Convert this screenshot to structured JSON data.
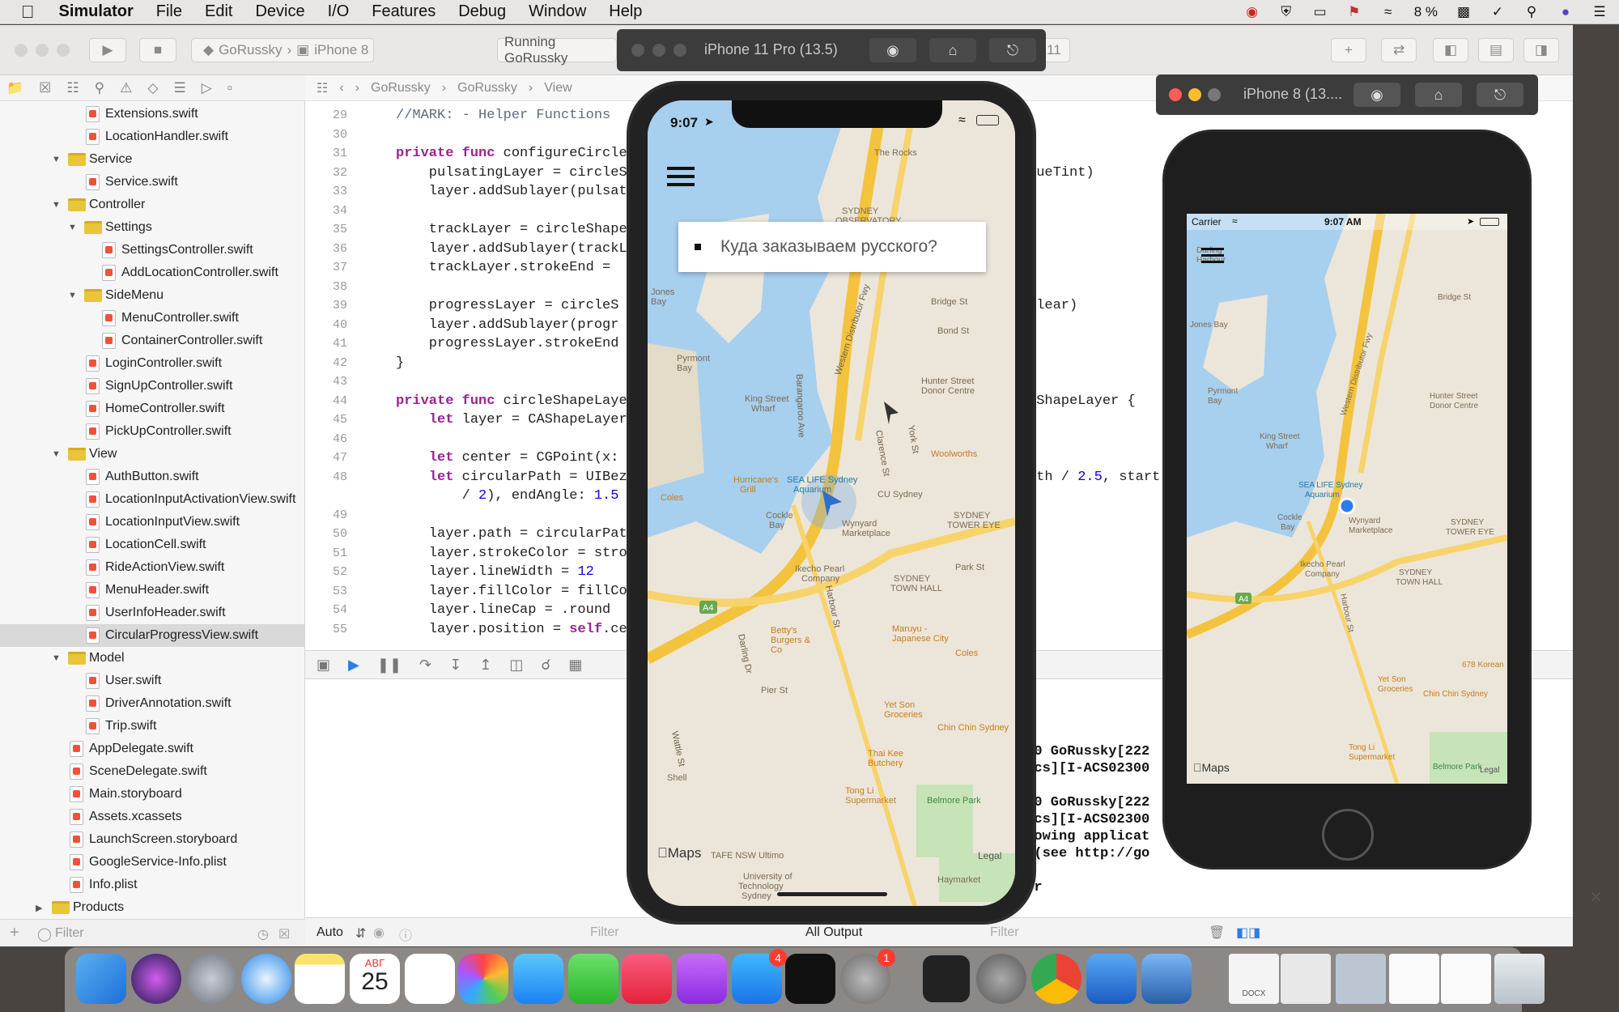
{
  "menubar": {
    "app": "Simulator",
    "items": [
      "File",
      "Edit",
      "Device",
      "I/O",
      "Features",
      "Debug",
      "Window",
      "Help"
    ],
    "battery": "8 %"
  },
  "toolbar": {
    "scheme": "GoRussky",
    "device": "iPhone 8",
    "status": "Running GoRussky",
    "warn_count": "11"
  },
  "jumpbar": [
    "GoRussky",
    "GoRussky",
    "View"
  ],
  "navigator": {
    "rows": [
      {
        "label": "Extensions.swift",
        "indent": 2,
        "kind": "file"
      },
      {
        "label": "LocationHandler.swift",
        "indent": 2,
        "kind": "file"
      },
      {
        "label": "Service",
        "indent": 1,
        "kind": "group"
      },
      {
        "label": "Service.swift",
        "indent": 2,
        "kind": "file"
      },
      {
        "label": "Controller",
        "indent": 1,
        "kind": "group"
      },
      {
        "label": "Settings",
        "indent": 2,
        "kind": "group"
      },
      {
        "label": "SettingsController.swift",
        "indent": 3,
        "kind": "file"
      },
      {
        "label": "AddLocationController.swift",
        "indent": 3,
        "kind": "file"
      },
      {
        "label": "SideMenu",
        "indent": 2,
        "kind": "group"
      },
      {
        "label": "MenuController.swift",
        "indent": 3,
        "kind": "file"
      },
      {
        "label": "ContainerController.swift",
        "indent": 3,
        "kind": "file"
      },
      {
        "label": "LoginController.swift",
        "indent": 2,
        "kind": "file"
      },
      {
        "label": "SignUpController.swift",
        "indent": 2,
        "kind": "file"
      },
      {
        "label": "HomeController.swift",
        "indent": 2,
        "kind": "file"
      },
      {
        "label": "PickUpController.swift",
        "indent": 2,
        "kind": "file"
      },
      {
        "label": "View",
        "indent": 1,
        "kind": "group"
      },
      {
        "label": "AuthButton.swift",
        "indent": 2,
        "kind": "file"
      },
      {
        "label": "LocationInputActivationView.swift",
        "indent": 2,
        "kind": "file"
      },
      {
        "label": "LocationInputView.swift",
        "indent": 2,
        "kind": "file"
      },
      {
        "label": "LocationCell.swift",
        "indent": 2,
        "kind": "file"
      },
      {
        "label": "RideActionView.swift",
        "indent": 2,
        "kind": "file"
      },
      {
        "label": "MenuHeader.swift",
        "indent": 2,
        "kind": "file"
      },
      {
        "label": "UserInfoHeader.swift",
        "indent": 2,
        "kind": "file"
      },
      {
        "label": "CircularProgressView.swift",
        "indent": 2,
        "kind": "file",
        "selected": true
      },
      {
        "label": "Model",
        "indent": 1,
        "kind": "group"
      },
      {
        "label": "User.swift",
        "indent": 2,
        "kind": "file"
      },
      {
        "label": "DriverAnnotation.swift",
        "indent": 2,
        "kind": "file"
      },
      {
        "label": "Trip.swift",
        "indent": 2,
        "kind": "file"
      },
      {
        "label": "AppDelegate.swift",
        "indent": 1,
        "kind": "file"
      },
      {
        "label": "SceneDelegate.swift",
        "indent": 1,
        "kind": "file"
      },
      {
        "label": "Main.storyboard",
        "indent": 1,
        "kind": "file"
      },
      {
        "label": "Assets.xcassets",
        "indent": 1,
        "kind": "file"
      },
      {
        "label": "LaunchScreen.storyboard",
        "indent": 1,
        "kind": "file"
      },
      {
        "label": "GoogleService-Info.plist",
        "indent": 1,
        "kind": "file"
      },
      {
        "label": "Info.plist",
        "indent": 1,
        "kind": "file"
      },
      {
        "label": "Products",
        "indent": 0,
        "kind": "group"
      }
    ],
    "filter_placeholder": "Filter"
  },
  "editor": {
    "lines": [
      {
        "n": "29",
        "t": "//MARK: - Helper Functions"
      },
      {
        "n": "30",
        "t": ""
      },
      {
        "n": "31",
        "t": "private func configureCircle"
      },
      {
        "n": "32",
        "t": "    pulsatingLayer = circleS"
      },
      {
        "n": "33",
        "t": "    layer.addSublayer(pulsat"
      },
      {
        "n": "34",
        "t": ""
      },
      {
        "n": "35",
        "t": "    trackLayer = circleShape"
      },
      {
        "n": "36",
        "t": "    layer.addSublayer(trackL"
      },
      {
        "n": "37",
        "t": "    trackLayer.strokeEnd = "
      },
      {
        "n": "38",
        "t": ""
      },
      {
        "n": "39",
        "t": "    progressLayer = circleS"
      },
      {
        "n": "40",
        "t": "    layer.addSublayer(progr"
      },
      {
        "n": "41",
        "t": "    progressLayer.strokeEnd"
      },
      {
        "n": "42",
        "t": "}"
      },
      {
        "n": "43",
        "t": ""
      },
      {
        "n": "44",
        "t": "private func circleShapeLaye"
      },
      {
        "n": "45",
        "t": "    let layer = CAShapeLayer"
      },
      {
        "n": "46",
        "t": ""
      },
      {
        "n": "47",
        "t": "    let center = CGPoint(x: "
      },
      {
        "n": "48",
        "t": "    let circularPath = UIBez"
      },
      {
        "n": "",
        "t": "        / 2), endAngle: 1.5 "
      },
      {
        "n": "49",
        "t": ""
      },
      {
        "n": "50",
        "t": "    layer.path = circularPat"
      },
      {
        "n": "51",
        "t": "    layer.strokeColor = stro"
      },
      {
        "n": "52",
        "t": "    layer.lineWidth = 12"
      },
      {
        "n": "53",
        "t": "    layer.fillColor = fillCo"
      },
      {
        "n": "54",
        "t": "    layer.lineCap = .round"
      },
      {
        "n": "55",
        "t": "    layer.position = self.ce"
      }
    ],
    "right_fragments": [
      {
        "line": "32",
        "t": "lueTint)"
      },
      {
        "line": "39",
        "t": "clear)"
      },
      {
        "line": "44",
        "t": "AShapeLayer {"
      },
      {
        "line": "48",
        "t": "dth / 2.5, start"
      }
    ]
  },
  "console": {
    "lines": [
      "300 GoRussky[222",
      "tics][I-ACS02300",
      "",
      "300 GoRussky[222",
      "tics][I-ACS02300",
      "llowing applicat",
      "d (see http://go",
      "",
      "ger",
      "",
      "ger"
    ]
  },
  "bottombar": {
    "auto": "Auto",
    "filter1": "Filter",
    "output": "All Output",
    "filter2": "Filter"
  },
  "sim11": {
    "title": "iPhone 11 Pro (13.5)",
    "time": "9:07",
    "search_prompt": "Куда заказываем русского?",
    "maps": "Maps",
    "legal": "Legal"
  },
  "sim8": {
    "title": "iPhone 8 (13....",
    "carrier": "Carrier",
    "time": "9:07 AM",
    "maps": "Maps",
    "legal": "Legal"
  },
  "map_labels": {
    "big": [
      "The Rocks",
      "SYDNEY OBSERVATORY",
      "Jones Bay",
      "Pyrmont Bay",
      "King Street Wharf",
      "Hunter Street Donor Centre",
      "Clarence St",
      "York St",
      "Woolworths",
      "SEA LIFE Sydney Aquarium",
      "Hurricane's Grill",
      "Cockle Bay",
      "Wynyard Marketplace",
      "CU Sydney",
      "SYDNEY TOWER EYE",
      "Ikecho Pearl Company",
      "SYDNEY TOWN HALL",
      "Park St",
      "Harbour St",
      "Darling Dr",
      "Betty's Burgers & Co",
      "Maruyu - Japanese City",
      "Pier St",
      "Yet Son Groceries",
      "Chin Chin Sydney",
      "Thai Kee Butchery",
      "Tong Li Supermarket",
      "Belmore Park",
      "TAFE NSW Ultimo",
      "University of Technology Sydney",
      "Haymarket",
      "Wattle St",
      "Bridge St",
      "Bond St",
      "Western Distributor Fwy",
      "Barangaroo Ave",
      "Coles",
      "Shell",
      "A4"
    ],
    "small": [
      "Darling Harbour",
      "Jones Bay",
      "Pyrmont Bay",
      "King Street Wharf",
      "Hunter Street Donor Centre",
      "SEA LIFE Sydney Aquarium",
      "Cockle Bay",
      "Wynyard Marketplace",
      "SYDNEY TOWER EYE",
      "Ikecho Pearl Company",
      "SYDNEY TOWN HALL",
      "Yet Son Groceries",
      "Chin Chin Sydney",
      "Tong Li Supermarket",
      "Belmore Park",
      "678 Korean",
      "Bridge St",
      "Harbour St",
      "A4",
      "Western Distributor Fwy"
    ]
  },
  "dock": {
    "calendar_month": "АВГ",
    "calendar_day": "25",
    "appstore_badge": "4",
    "prefs_badge": "1",
    "docx_label": "DOCX"
  },
  "colors": {
    "accent": "#2b7de9",
    "water": "#a7cfee",
    "road": "#f7d36b",
    "swift": "#f05138",
    "keyword": "#9b2393"
  }
}
